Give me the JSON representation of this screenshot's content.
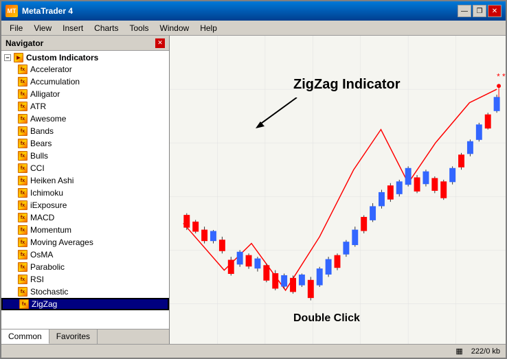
{
  "window": {
    "title": "MetaTrader 4",
    "controls": {
      "minimize": "—",
      "restore": "❐",
      "close": "✕"
    }
  },
  "menubar": {
    "items": [
      "File",
      "View",
      "Insert",
      "Charts",
      "Tools",
      "Window",
      "Help"
    ]
  },
  "navigator": {
    "title": "Navigator",
    "sections": [
      {
        "label": "Custom Indicators",
        "expanded": true,
        "items": [
          "Accelerator",
          "Accumulation",
          "Alligator",
          "ATR",
          "Awesome",
          "Bands",
          "Bears",
          "Bulls",
          "CCI",
          "Heiken Ashi",
          "Ichimoku",
          "iExposure",
          "MACD",
          "Momentum",
          "Moving Averages",
          "OsMA",
          "Parabolic",
          "RSI",
          "Stochastic",
          "ZigZag"
        ]
      }
    ],
    "tabs": [
      "Common",
      "Favorites"
    ]
  },
  "chart": {
    "label_zigzag": "ZigZag Indicator",
    "label_double_click": "Double Click"
  },
  "statusbar": {
    "grid_icon": "▦",
    "memory": "222/0 kb"
  }
}
